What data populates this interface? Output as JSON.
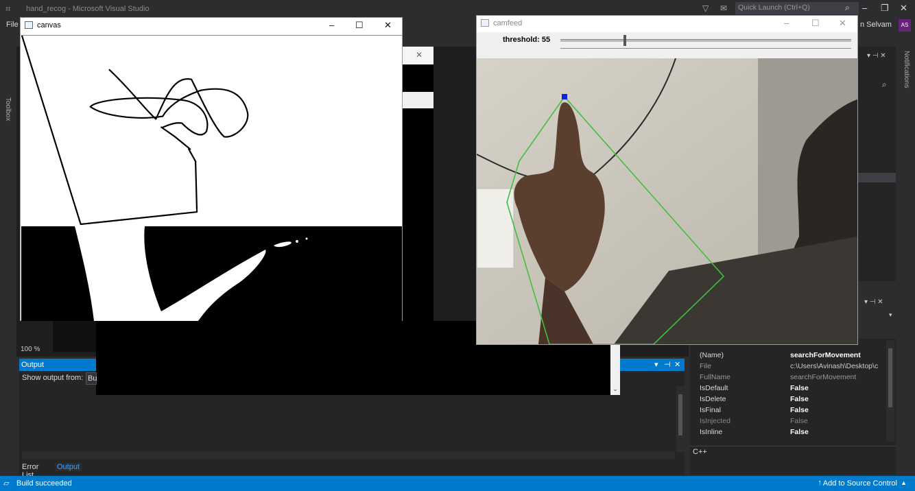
{
  "vs": {
    "title": "hand_recog - Microsoft Visual Studio",
    "menu_file": "File",
    "quick_launch": "Quick Launch (Ctrl+Q)",
    "user": "n Selvam",
    "avatar": "AS",
    "toolbox": "Toolbox",
    "notifications": "Notifications",
    "zoom": "100 %"
  },
  "output": {
    "title": "Output",
    "show_from": "Show output from:",
    "show_value": "Bu"
  },
  "tabs": [
    "Error List",
    "Output"
  ],
  "properties": {
    "desc": "C++",
    "rows": [
      {
        "k": "(Name)",
        "v": "searchForMovement",
        "bold": true
      },
      {
        "k": "File",
        "v": "c:\\Users\\Avinash\\Desktop\\c",
        "bold": false
      },
      {
        "k": "FullName",
        "v": "searchForMovement",
        "bold": false
      },
      {
        "k": "IsDefault",
        "v": "False",
        "bold": true
      },
      {
        "k": "IsDelete",
        "v": "False",
        "bold": true
      },
      {
        "k": "IsFinal",
        "v": "False",
        "bold": true
      },
      {
        "k": "IsInjected",
        "v": "False",
        "bold": false
      },
      {
        "k": "IsInline",
        "v": "False",
        "bold": true
      }
    ]
  },
  "status": {
    "left": "Build succeeded",
    "right": "Add to Source Control"
  },
  "canvas_window": {
    "title": "canvas"
  },
  "cam_window": {
    "title": "camfeed",
    "threshold_label": "threshold: 55",
    "threshold_value": 55
  },
  "colors": {
    "accent": "#007acc",
    "hull": "#3fbf3f",
    "fingertip": "#1020e0"
  }
}
